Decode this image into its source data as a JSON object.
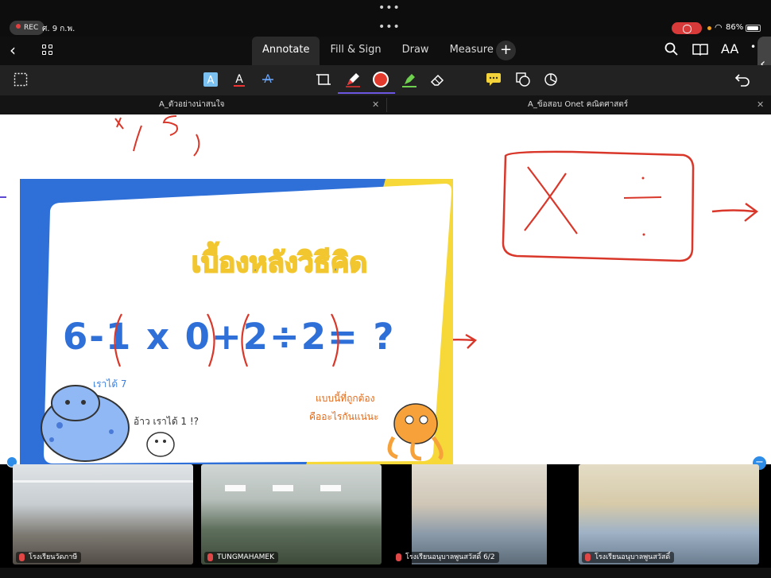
{
  "status_bar": {
    "recording_label": "REC",
    "date": "ศ. 9 ก.พ.",
    "top_dots": "•••",
    "battery_percent": "86%",
    "battery_level": 0.86
  },
  "tab_bar": {
    "tab_dots": "•••",
    "tabs": [
      {
        "label": "Annotate",
        "active": true
      },
      {
        "label": "Fill & Sign",
        "active": false
      },
      {
        "label": "Draw",
        "active": false
      },
      {
        "label": "Measure",
        "active": false
      }
    ],
    "add_label": "+",
    "aa_label": "AA",
    "more_label": "•"
  },
  "tools": [
    "select-rect-icon",
    "text-highlight-icon",
    "text-color-icon",
    "text-strike-icon",
    "crop-icon",
    "pen-icon",
    "color-red-swatch",
    "highlighter-icon",
    "eraser-icon",
    "comment-icon",
    "shapes-icon",
    "lasso-icon",
    "undo-icon"
  ],
  "active_color": "#e23b2e",
  "doc_tabs": [
    {
      "title": "A_ตัวอย่างน่าสนใจ",
      "close": "✕"
    },
    {
      "title": "A_ข้อสอบ Onet คณิตศาสตร์",
      "close": "✕"
    }
  ],
  "slide": {
    "title": "เบื้องหลังวิธีคิด",
    "equation": "6-1 x 0+2÷2= ?",
    "bubble_left": "เราได้ 7",
    "bubble_mid": "อ้าว เราได้ 1 !?",
    "bubble_right_line1": "แบบนี้ที่ถูกต้อง",
    "bubble_right_line2": "คืออะไรกันแน่นะ",
    "colors": {
      "blue": "#2f6fd8",
      "yellow": "#f6d838",
      "title_fill": "#3f80e0",
      "title_outline": "#f2c62e"
    }
  },
  "annotations": {
    "top_fragment": "+ , 5 ,",
    "box_symbols": [
      "X",
      "÷"
    ],
    "stroke_color": "#d9372a"
  },
  "participants": [
    {
      "label": "โรงเรียนวัดภาษี"
    },
    {
      "label": "TUNGMAHAMEK"
    },
    {
      "label": "โรงเรียนอนุบาลพูนสวัสดิ์ 6/2"
    },
    {
      "label": "โรงเรียนอนุบาลพูนสวัสดิ์"
    }
  ]
}
